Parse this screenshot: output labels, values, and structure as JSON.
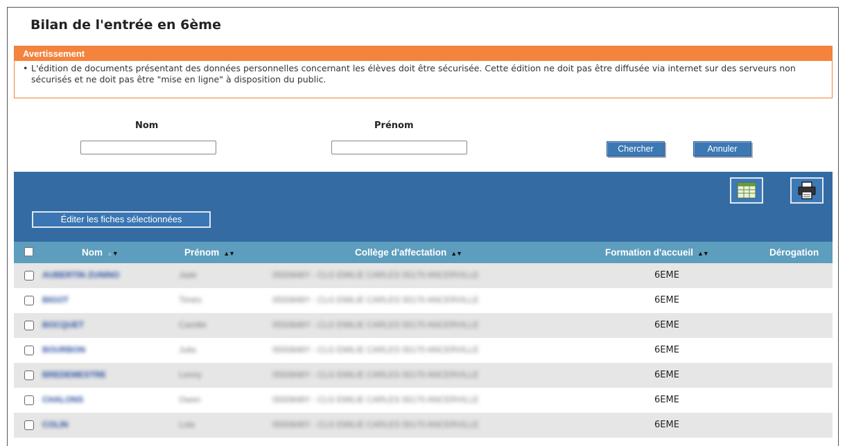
{
  "page": {
    "title": "Bilan de l'entrée en 6ème"
  },
  "warning": {
    "heading": "Avertissement",
    "bullet": "•",
    "text": "L'édition de documents présentant des données personnelles concernant les élèves doit être sécurisée. Cette édition ne doit pas être diffusée via internet sur des serveurs non sécurisés et ne doit pas être \"mise en ligne\" à disposition du public."
  },
  "search": {
    "nom_label": "Nom",
    "nom_value": "",
    "prenom_label": "Prénom",
    "prenom_value": "",
    "search_button": "Chercher",
    "cancel_button": "Annuler"
  },
  "toolbar": {
    "export_icon": "spreadsheet-icon",
    "print_icon": "printer-icon",
    "edit_selected_button": "Éditer les fiches sélectionnées"
  },
  "table": {
    "columns": {
      "nom": "Nom",
      "prenom": "Prénom",
      "college": "Collège d'affectation",
      "formation": "Formation d'accueil",
      "derogation": "Dérogation"
    },
    "sort_glyph": "▲▼",
    "rows": [
      {
        "nom": "AUBERTIN ZUNINO",
        "prenom": "Jade",
        "college": "0550848Y - CLG EMILIE CARLES 55170 ANCERVILLE",
        "formation": "6EME",
        "derogation": ""
      },
      {
        "nom": "BIGOT",
        "prenom": "Timéo",
        "college": "0550848Y - CLG EMILIE CARLES 55170 ANCERVILLE",
        "formation": "6EME",
        "derogation": ""
      },
      {
        "nom": "BOCQUET",
        "prenom": "Camille",
        "college": "0550848Y - CLG EMILIE CARLES 55170 ANCERVILLE",
        "formation": "6EME",
        "derogation": ""
      },
      {
        "nom": "BOURBON",
        "prenom": "Julia",
        "college": "0550848Y - CLG EMILIE CARLES 55170 ANCERVILLE",
        "formation": "6EME",
        "derogation": ""
      },
      {
        "nom": "BREDEMESTRE",
        "prenom": "Lenny",
        "college": "0550848Y - CLG EMILIE CARLES 55170 ANCERVILLE",
        "formation": "6EME",
        "derogation": ""
      },
      {
        "nom": "CHALONS",
        "prenom": "Owen",
        "college": "0550848Y - CLG EMILIE CARLES 55170 ANCERVILLE",
        "formation": "6EME",
        "derogation": ""
      },
      {
        "nom": "COLIN",
        "prenom": "Lola",
        "college": "0550848Y - CLG EMILIE CARLES 55170 ANCERVILLE",
        "formation": "6EME",
        "derogation": ""
      }
    ]
  },
  "colors": {
    "warning_orange": "#f4833e",
    "toolbar_blue": "#356ba3",
    "header_blue": "#5d9dbd",
    "link_blue": "#2a4fa0"
  }
}
